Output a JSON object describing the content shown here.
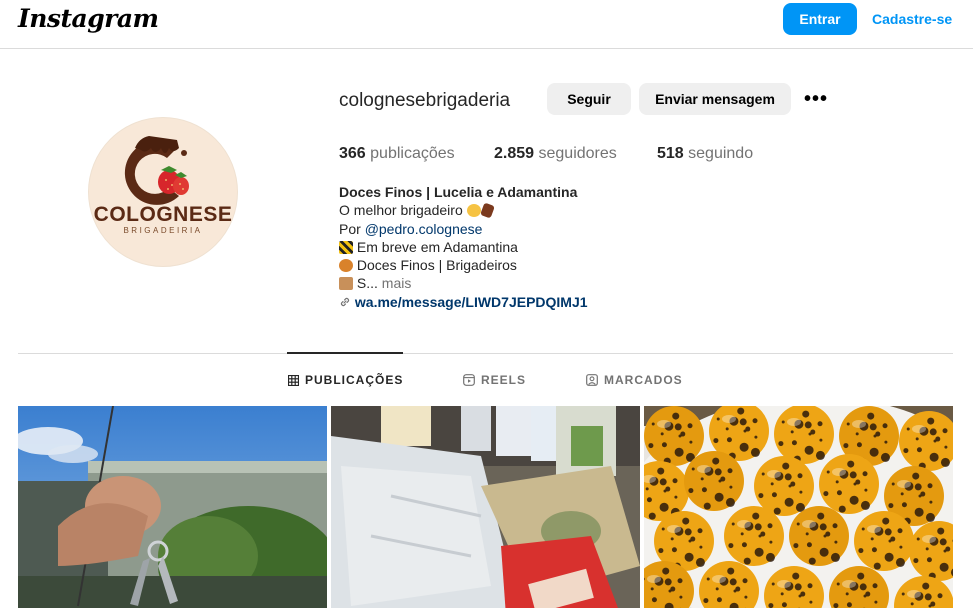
{
  "header": {
    "logo": "Instagram",
    "login_label": "Entrar",
    "signup_label": "Cadastre-se"
  },
  "profile": {
    "avatar_brand": "COLOGNESE",
    "avatar_sub": "BRIGADEIRIA",
    "username": "colognesebrigaderia",
    "follow_label": "Seguir",
    "message_label": "Enviar mensagem",
    "more_label": "•••",
    "stats": {
      "posts_count": "366",
      "posts_label": "publicações",
      "followers_count": "2.859",
      "followers_label": "seguidores",
      "following_count": "518",
      "following_label": "seguindo"
    },
    "bio": {
      "name": "Doces Finos | Lucelia e Adamantina",
      "line1": "O melhor brigadeiro",
      "by_prefix": "Por ",
      "mention": "@pedro.colognese",
      "line3": "Em breve em Adamantina",
      "line4": "Doces Finos | Brigadeiros",
      "line5": "S...",
      "more": "mais",
      "link": "wa.me/message/LIWD7JEPDQIMJ1"
    }
  },
  "tabs": [
    {
      "label": "PUBLICAÇÕES",
      "icon": "grid-icon",
      "active": true
    },
    {
      "label": "REELS",
      "icon": "reels-icon",
      "active": false
    },
    {
      "label": "MARCADOS",
      "icon": "tagged-icon",
      "active": false
    }
  ],
  "colors": {
    "accent": "#0095f6",
    "link": "#00376b",
    "muted": "#737373",
    "button_bg": "#efefef"
  }
}
